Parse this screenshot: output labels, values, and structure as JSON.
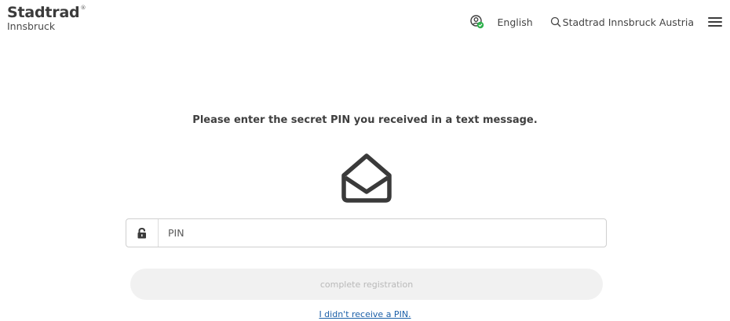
{
  "header": {
    "logo_name": "Stadtrad",
    "logo_reg_mark": "®",
    "logo_city": "Innsbruck",
    "account_icon": "account-icon",
    "language_label": "English",
    "search_icon": "search-icon",
    "search_label": "Stadtrad Innsbruck Austria",
    "menu_icon": "hamburger-menu-icon"
  },
  "main": {
    "instruction": "Please enter the secret PIN you received in a text message.",
    "envelope_icon": "envelope-open-icon",
    "pin_field": {
      "lock_icon": "unlock-icon",
      "placeholder": "PIN",
      "value": ""
    },
    "complete_button_label": "complete registration",
    "no_pin_link": "I didn't receive a PIN."
  },
  "colors": {
    "text": "#3c3c3c",
    "link": "#1b5fa8",
    "button_disabled_bg": "#f1f1f1",
    "button_disabled_text": "#b9b9b9",
    "status_green": "#2fb14d"
  }
}
